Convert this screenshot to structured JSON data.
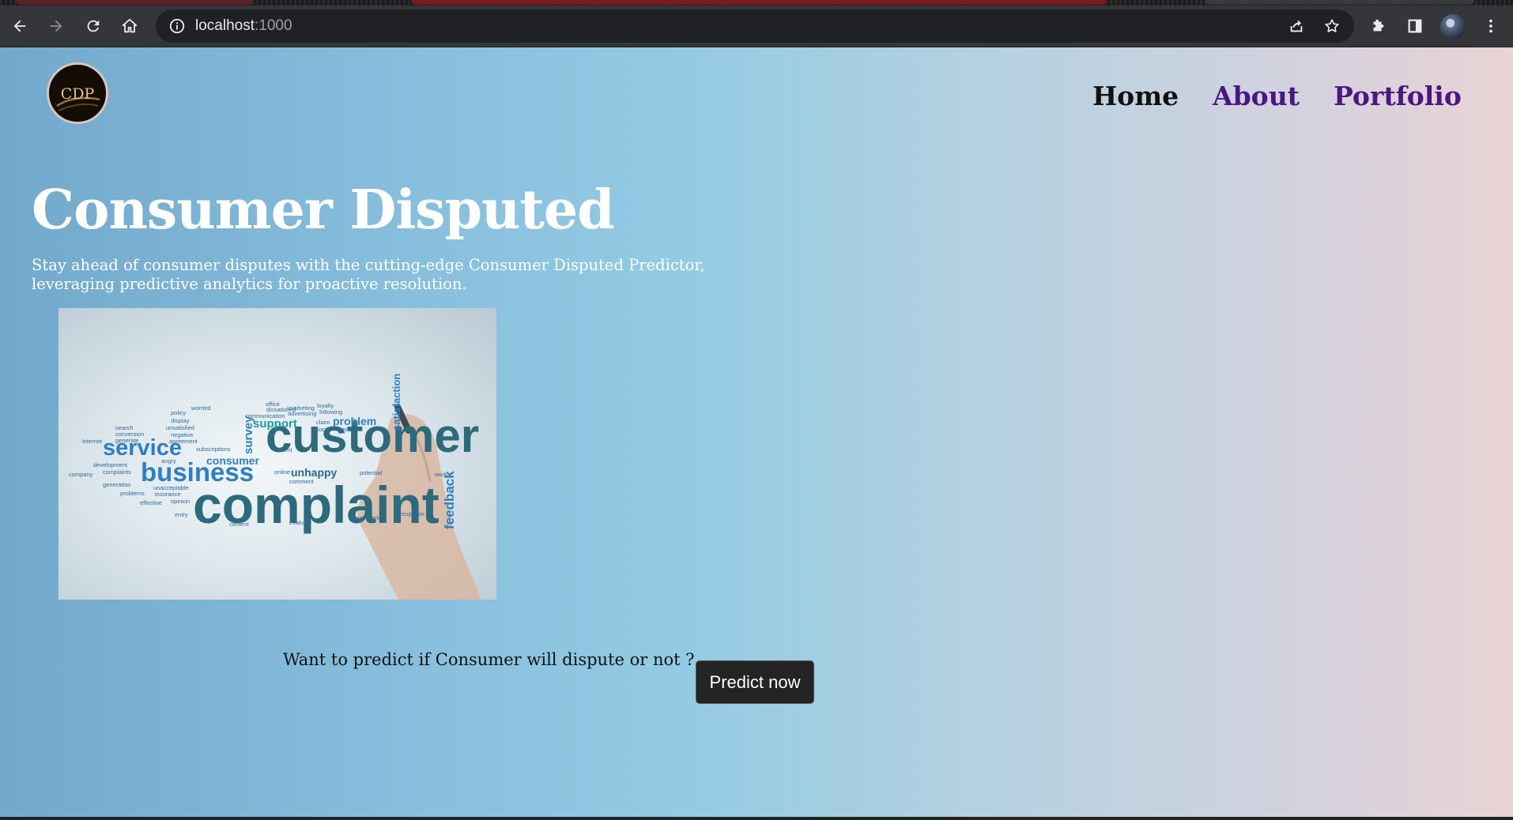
{
  "browser": {
    "url_host": "localhost",
    "url_port": ":1000",
    "icons": {
      "back": "back-arrow-icon",
      "forward": "forward-arrow-icon",
      "reload": "reload-icon",
      "home": "home-icon",
      "info": "info-icon",
      "share": "share-icon",
      "bookmark": "star-icon",
      "extensions": "puzzle-icon",
      "side_panel": "side-panel-icon",
      "menu": "kebab-menu-icon"
    }
  },
  "header": {
    "logo_text": "CDP",
    "nav": {
      "home": "Home",
      "about": "About",
      "portfolio": "Portfolio"
    }
  },
  "hero": {
    "title": "Consumer Disputed",
    "subtitle": "Stay ahead of consumer disputes with the cutting-edge Consumer Disputed Predictor, leveraging predictive analytics for proactive resolution.",
    "image": {
      "words": {
        "customer": "customer",
        "complaint": "complaint",
        "business": "business",
        "service": "service",
        "support": "support",
        "problem": "problem",
        "unhappy": "unhappy",
        "feedback": "feedback",
        "satisfaction": "satisfaction",
        "consumer": "consumer",
        "survey": "survey",
        "dissatisfied": "dissatisfied",
        "policy": "policy",
        "display": "display",
        "worried": "worried",
        "unsatisfied": "unsatisfied",
        "negative": "negative",
        "search": "search",
        "conversion": "conversion",
        "internet": "internet",
        "generate": "generate",
        "agreement": "agreement",
        "subscriptions": "subscriptions",
        "angry": "angry",
        "development": "development",
        "company": "company",
        "complaints": "complaints",
        "generation": "generation",
        "unacceptable": "unacceptable",
        "problems": "problems",
        "insurance": "insurance",
        "effective": "effective",
        "opinion": "opinion",
        "entry": "entry",
        "content": "content",
        "evaluate": "evaluate",
        "teamwork": "teamwork",
        "response": "response",
        "comment": "comment",
        "online": "online",
        "marketing": "marketing",
        "office": "office",
        "communication": "communication",
        "advertising": "advertising",
        "following": "following",
        "loyalty": "loyalty",
        "social": "social",
        "media": "media",
        "client": "client",
        "claim": "claim",
        "potential": "potential",
        "work": "work"
      }
    }
  },
  "cta": {
    "question": "Want to predict if Consumer will dispute or not ?",
    "button": "Predict now"
  },
  "colors": {
    "nav_active": "#111111",
    "nav_link": "#4b1682",
    "button_bg": "#242424",
    "word_dark": "#2d6a7c",
    "word_blue": "#2f7fc1",
    "word_teal": "#1d9aa3"
  }
}
